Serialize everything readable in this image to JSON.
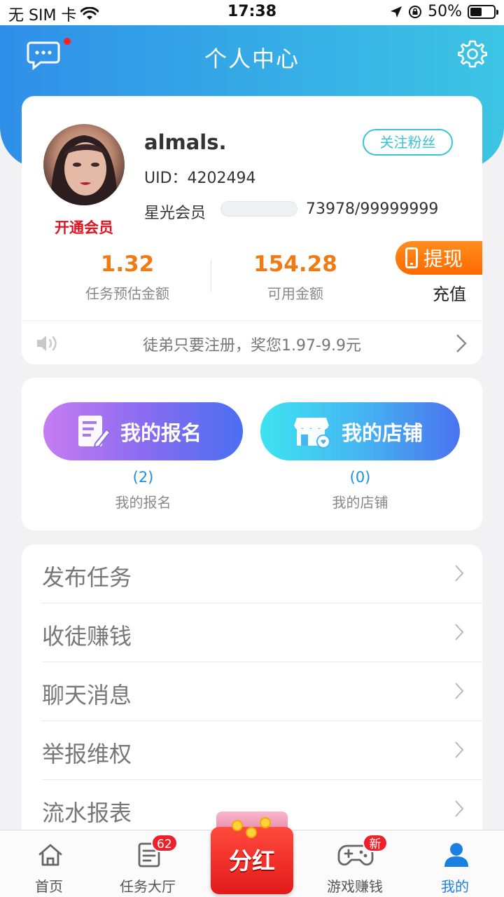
{
  "status_bar": {
    "carrier": "无 SIM 卡",
    "time": "17:38",
    "battery": "50%",
    "battery_level": 0.5
  },
  "header": {
    "title": "个人中心",
    "message_icon": "chat-bubble-icon",
    "settings_icon": "gear-icon",
    "has_unread": true
  },
  "profile": {
    "username": "almals.",
    "uid": "UID：4202494",
    "follow_label": "关注粉丝",
    "vip_label": "开通会员",
    "member_label": "星光会员",
    "member_progress": "73978/99999999",
    "member_progress_fraction": 0.0007,
    "stats": [
      {
        "value": "1.32",
        "label": "任务预估金额"
      },
      {
        "value": "154.28",
        "label": "可用金额"
      }
    ],
    "withdraw_label": "提现",
    "recharge_label": "充值",
    "notice": "徒弟只要注册，奖您1.97-9.9元"
  },
  "actions": [
    {
      "button_label": "我的报名",
      "count": "(2)",
      "label": "我的报名",
      "icon": "form-edit-icon"
    },
    {
      "button_label": "我的店铺",
      "count": "(0)",
      "label": "我的店铺",
      "icon": "shop-icon"
    }
  ],
  "menu": [
    {
      "label": "发布任务"
    },
    {
      "label": "收徒赚钱"
    },
    {
      "label": "聊天消息"
    },
    {
      "label": "举报维权"
    },
    {
      "label": "流水报表"
    }
  ],
  "tabbar": {
    "home": {
      "label": "首页",
      "icon": "home-icon"
    },
    "tasks": {
      "label": "任务大厅",
      "badge": "62",
      "icon": "task-list-icon"
    },
    "bonus": {
      "label": "分红",
      "icon": "red-packet-icon"
    },
    "games": {
      "label": "游戏赚钱",
      "badge": "新",
      "icon": "gamepad-icon"
    },
    "mine": {
      "label": "我的",
      "icon": "user-icon",
      "active": true
    }
  },
  "colors": {
    "accent_blue": "#2f8fe8",
    "accent_cyan": "#3cc5e4",
    "orange": "#f07a13",
    "vip_red": "#e0141e",
    "tab_active": "#1b80e2"
  }
}
